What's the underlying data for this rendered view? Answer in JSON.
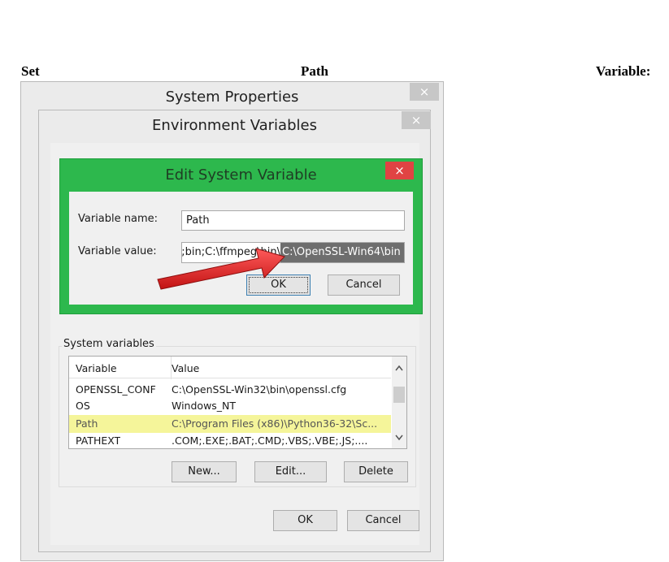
{
  "heading": {
    "word1": "Set",
    "word2": "Path",
    "word3": "Variable:"
  },
  "system_properties": {
    "title": "System Properties",
    "close": "×"
  },
  "environment_variables": {
    "title": "Environment Variables",
    "close": "×",
    "system_variables_label": "System variables",
    "columns": [
      "Variable",
      "Value"
    ],
    "rows": [
      {
        "variable": "OPENSSL_CONF",
        "value": "C:\\OpenSSL-Win32\\bin\\openssl.cfg"
      },
      {
        "variable": "OS",
        "value": "Windows_NT"
      },
      {
        "variable": "Path",
        "value": "C:\\Program Files (x86)\\Python36-32\\Sc..."
      },
      {
        "variable": "PATHEXT",
        "value": ".COM;.EXE;.BAT;.CMD;.VBS;.VBE;.JS;...."
      }
    ],
    "new_button": "New...",
    "edit_button": "Edit...",
    "delete_button": "Delete",
    "ok_button": "OK",
    "cancel_button": "Cancel"
  },
  "edit_system_variable": {
    "title": "Edit System Variable",
    "close": "×",
    "name_label": "Variable name:",
    "name_value": "Path",
    "value_label": "Variable value:",
    "value_plain": "\\bin;C:\\ffmpeg\\bin;",
    "value_selected": "C:\\OpenSSL-Win64\\bin",
    "ok_button": "OK",
    "cancel_button": "Cancel"
  },
  "colors": {
    "accent": "#2db84d",
    "highlight_row": "#f5f59a",
    "close_red": "#e04343",
    "selection": "#6e6e6e"
  }
}
